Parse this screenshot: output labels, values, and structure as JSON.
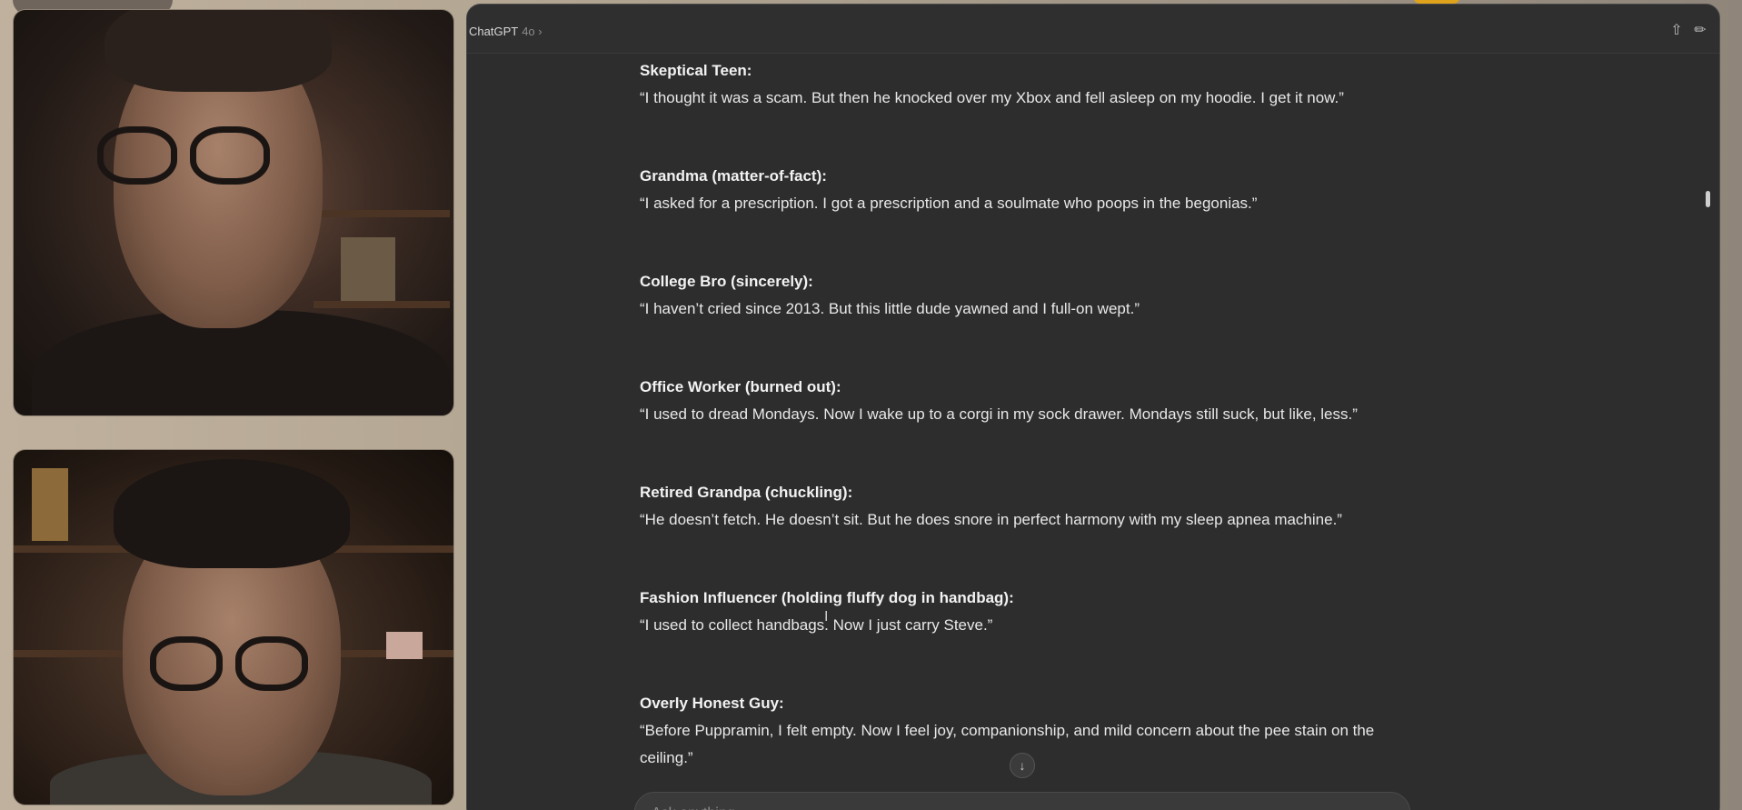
{
  "window": {
    "model_name": "ChatGPT",
    "model_version": "4o"
  },
  "icons": {
    "share": "share-icon",
    "new_chat": "new-chat-icon",
    "scroll_down": "arrow-down-icon"
  },
  "messages": [
    {
      "speaker": "Skeptical Teen:",
      "text": "“I thought it was a scam. But then he knocked over my Xbox and fell asleep on my hoodie. I get it now.”"
    },
    {
      "speaker": "Grandma (matter-of-fact):",
      "text": "“I asked for a prescription. I got a prescription and a soulmate who poops in the begonias.”"
    },
    {
      "speaker": "College Bro (sincerely):",
      "text": "“I haven’t cried since 2013. But this little dude yawned and I full-on wept.”"
    },
    {
      "speaker": "Office Worker (burned out):",
      "text": "“I used to dread Mondays. Now I wake up to a corgi in my sock drawer. Mondays still suck, but like, less.”"
    },
    {
      "speaker": "Retired Grandpa (chuckling):",
      "text": "“He doesn’t fetch. He doesn’t sit. But he does snore in perfect harmony with my sleep apnea machine.”"
    },
    {
      "speaker": "Fashion Influencer (holding fluffy dog in handbag):",
      "text": "“I used to collect handbags. Now I just carry Steve.”"
    },
    {
      "speaker": "Overly Honest Guy:",
      "text": "“Before Puppramin, I felt empty. Now I feel joy, companionship, and mild concern about the pee stain on the ceiling.”"
    }
  ],
  "composer": {
    "placeholder": "Ask anything"
  },
  "colors": {
    "chat_background": "#2d2d2d",
    "text_primary": "#e8e8e8",
    "accent": "#e0a21a"
  }
}
